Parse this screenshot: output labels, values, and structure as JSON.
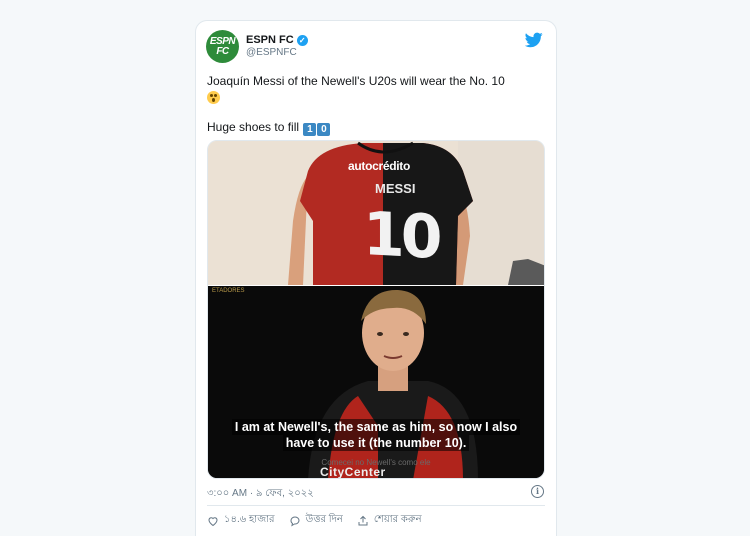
{
  "tweet": {
    "author_name": "ESPN FC",
    "author_handle": "@ESPNFC",
    "avatar_text_line1": "ESPN",
    "avatar_text_line2": "FC",
    "text_line1": "Joaquín Messi of the Newell's U20s will wear the No. 10",
    "text_line2": "Huge shoes to fill",
    "keycap_1": "1",
    "keycap_2": "0",
    "timestamp": "৩:০০ AM · ৯ ফেব, ২০২২"
  },
  "media": {
    "subtitle_line1": "I am at Newell's, the same as him, so now I also",
    "subtitle_line2": "have to use it (the number 10).",
    "faint_caption": "Comecei no Newell's como ele",
    "jersey_sponsor": "autocrédito",
    "jersey_name": "MESSI",
    "jersey_number": "10",
    "bottom_sponsor": "CityCenter",
    "league_logo_text": "ETADORES"
  },
  "actions": {
    "like_label": "১৪.৬ হাজার",
    "reply_label": "উত্তর দিন",
    "share_label": "শেয়ার করুন"
  },
  "colors": {
    "twitter_blue": "#1da1f2",
    "espn_green": "#2e8b3a",
    "muted_text": "#657786"
  },
  "icons": [
    "twitter-bird-icon",
    "verified-badge-icon",
    "astonished-face-emoji-icon",
    "keycap-icon",
    "info-icon",
    "heart-icon",
    "reply-bubble-icon",
    "share-icon"
  ]
}
